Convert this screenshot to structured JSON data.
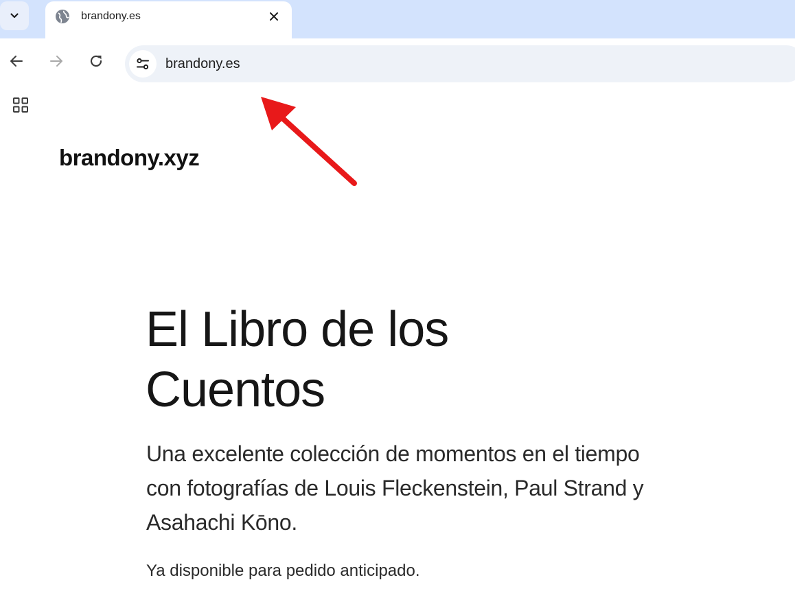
{
  "tab": {
    "title": "brandony.es"
  },
  "omnibox": {
    "url": "brandony.es"
  },
  "page": {
    "logo": "brandony.xyz",
    "title_line1": "El Libro de los",
    "title_line2": "Cuentos",
    "subtitle": "Una excelente colección de momentos en el tiempo con fotografías de Louis Fleckenstein, Paul Strand y Asahachi Kōno.",
    "note": "Ya disponible para pedido anticipado."
  },
  "icons": {
    "tab_search": "chevron-down-icon",
    "favicon": "globe-icon",
    "tab_close": "close-icon",
    "back": "arrow-left-icon",
    "forward": "arrow-right-icon",
    "reload": "reload-icon",
    "site_info": "tune-icon",
    "apps": "apps-grid-icon"
  },
  "colors": {
    "tabstrip_bg": "#d3e3fd",
    "omnibox_bg": "#eef2f8",
    "annotation_arrow": "#e8191a"
  }
}
